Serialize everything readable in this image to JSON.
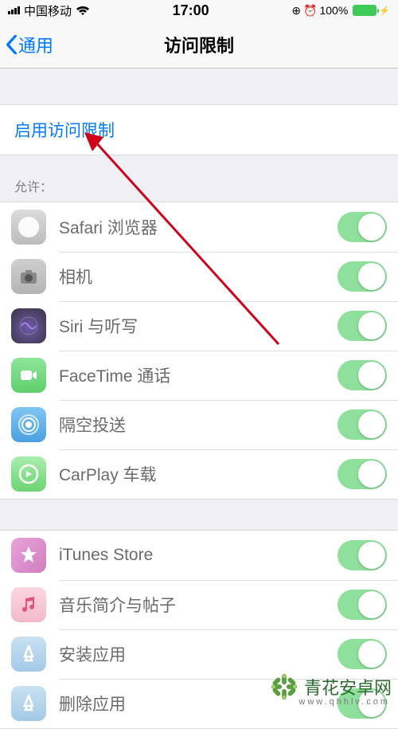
{
  "status": {
    "carrier": "中国移动",
    "time": "17:00",
    "battery_pct": "100%"
  },
  "nav": {
    "back": "通用",
    "title": "访问限制"
  },
  "enable_label": "启用访问限制",
  "allow_header": "允许：",
  "rows1": [
    {
      "label": "Safari 浏览器",
      "icon": "safari"
    },
    {
      "label": "相机",
      "icon": "camera"
    },
    {
      "label": "Siri 与听写",
      "icon": "siri"
    },
    {
      "label": "FaceTime 通话",
      "icon": "facetime"
    },
    {
      "label": "隔空投送",
      "icon": "airdrop"
    },
    {
      "label": "CarPlay 车载",
      "icon": "carplay"
    }
  ],
  "rows2": [
    {
      "label": "iTunes Store",
      "icon": "itunes"
    },
    {
      "label": "音乐简介与帖子",
      "icon": "music"
    },
    {
      "label": "安装应用",
      "icon": "install"
    },
    {
      "label": "删除应用",
      "icon": "delete"
    }
  ],
  "watermark": {
    "brand": "青花安卓网",
    "url": "www.qhhlv.com"
  }
}
